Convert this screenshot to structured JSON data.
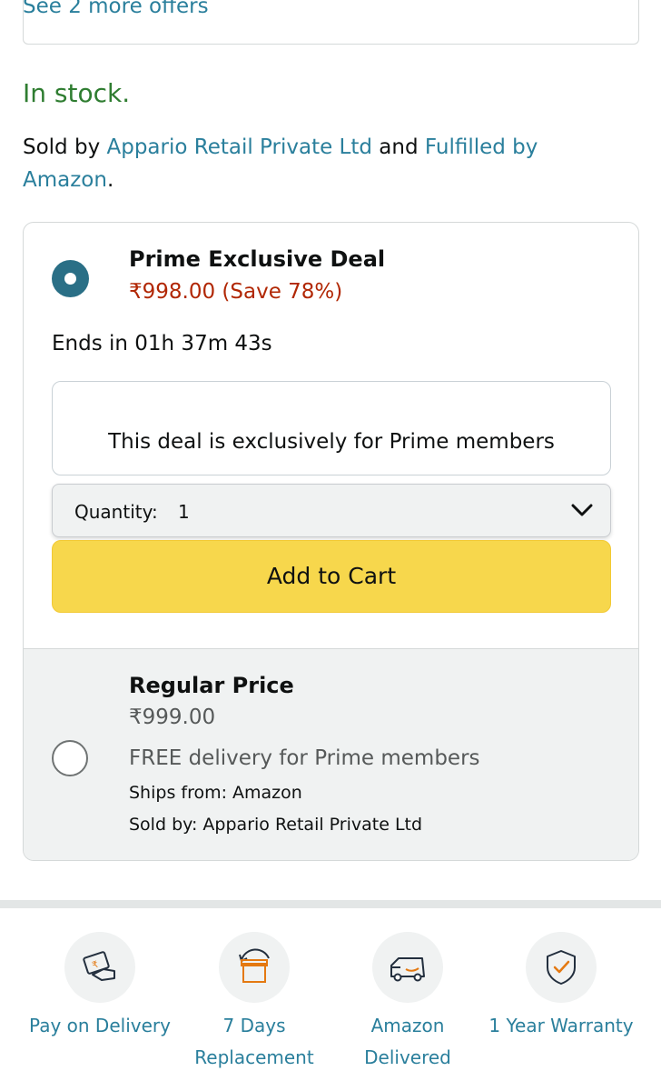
{
  "offers": {
    "link": "See 2 more offers"
  },
  "stock": {
    "status": "In stock."
  },
  "seller": {
    "sold_by_prefix": "Sold by ",
    "seller_name": "Appario Retail Private Ltd",
    "and_text": " and ",
    "fulfilled_link": "Fulfilled by Amazon",
    "period": "."
  },
  "deal": {
    "title": "Prime Exclusive Deal",
    "price": "₹998.00 (Save 78%)",
    "ends": "Ends in 01h 37m 43s",
    "exclusive_note": "This deal is exclusively for Prime members"
  },
  "quantity": {
    "label": "Quantity:",
    "value": "1"
  },
  "cart": {
    "label": "Add to Cart"
  },
  "regular": {
    "title": "Regular Price",
    "price": "₹999.00",
    "delivery": "FREE delivery for Prime members",
    "ships_from": "Ships from: Amazon",
    "sold_by": "Sold by: Appario Retail Private Ltd"
  },
  "features": [
    {
      "label": "Pay on Delivery",
      "icon": "cash-payment-icon"
    },
    {
      "label": "7 Days Replacement",
      "icon": "replacement-box-icon"
    },
    {
      "label": "Amazon Delivered",
      "icon": "delivery-truck-icon"
    },
    {
      "label": "1 Year Warranty",
      "icon": "warranty-shield-icon"
    }
  ],
  "colors": {
    "link": "#2a7f9c",
    "stock": "#2f7d31",
    "deal_price": "#b12704",
    "cart_button": "#f7d74c",
    "radio_selected": "#2a6f86",
    "icon_accent": "#e47911"
  }
}
